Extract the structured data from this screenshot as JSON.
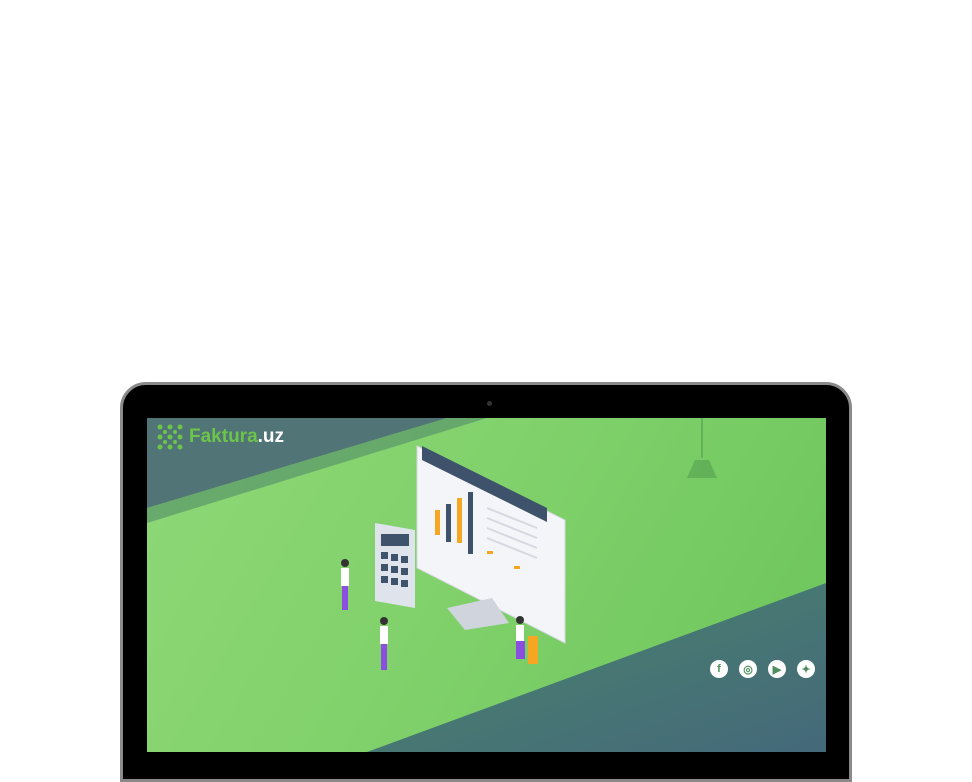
{
  "brand": {
    "name": "Faktura",
    "suffix": ".uz"
  },
  "colors": {
    "accent": "#6cc54a",
    "dark": "#4e6f76",
    "bar": "#f5a623"
  },
  "social": [
    {
      "icon": "facebook-icon",
      "glyph": "f"
    },
    {
      "icon": "instagram-icon",
      "glyph": "◎"
    },
    {
      "icon": "youtube-icon",
      "glyph": "▶"
    },
    {
      "icon": "twitter-icon",
      "glyph": "✦"
    }
  ]
}
